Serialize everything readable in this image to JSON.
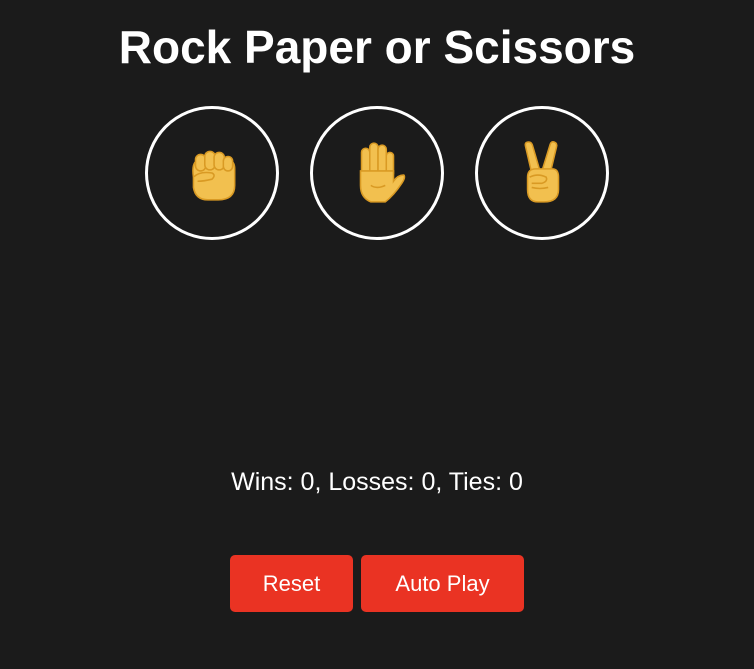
{
  "title": "Rock Paper or Scissors",
  "moves": [
    {
      "name": "rock",
      "icon": "raised-fist-icon"
    },
    {
      "name": "paper",
      "icon": "raised-hand-icon"
    },
    {
      "name": "scissors",
      "icon": "victory-hand-icon"
    }
  ],
  "score": {
    "text": "Wins: 0, Losses: 0, Ties: 0",
    "wins": 0,
    "losses": 0,
    "ties": 0
  },
  "controls": {
    "reset_label": "Reset",
    "auto_play_label": "Auto Play"
  },
  "colors": {
    "background": "#1b1b1b",
    "button_red": "#ea3323",
    "emoji_yellow": "#f2c04f",
    "emoji_line": "#d99a24"
  }
}
